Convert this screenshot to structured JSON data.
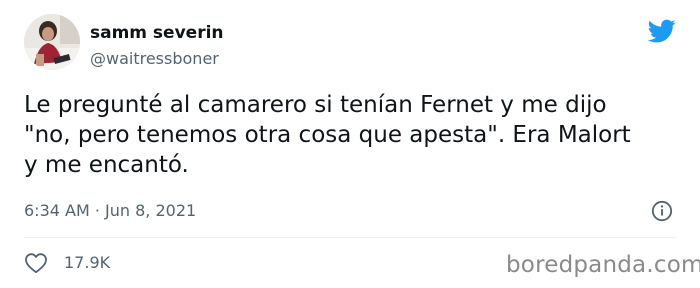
{
  "tweet": {
    "author": {
      "display_name": "samm severin",
      "handle": "@waitressboner"
    },
    "text_lines": [
      "Le pregunté al camarero si tenían Fernet y me dijo",
      "\"no, pero tenemos otra cosa que apesta\". Era Malort",
      "y me encantó."
    ],
    "timestamp": "6:34 AM · Jun 8, 2021",
    "likes": "17.9K"
  },
  "icons": {
    "brand": "twitter-bird-icon",
    "info": "info-icon",
    "like": "heart-icon"
  },
  "colors": {
    "twitter_blue": "#1d9bf0",
    "text_primary": "#0f1419",
    "text_secondary": "#536471",
    "watermark": "#8a8a8a"
  },
  "watermark": "boredpanda.com"
}
